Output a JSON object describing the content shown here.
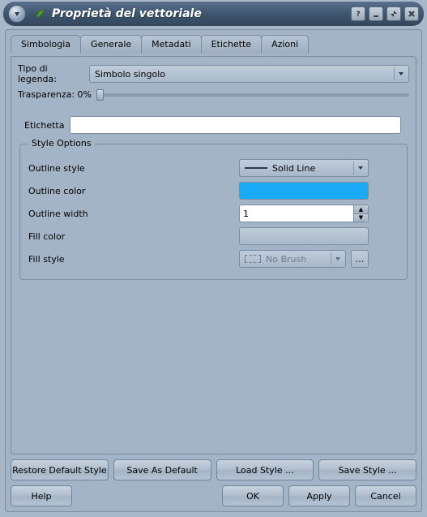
{
  "window": {
    "title": "Proprietà del vettoriale"
  },
  "tabs": {
    "simbologia": "Simbologia",
    "generale": "Generale",
    "metadati": "Metadati",
    "etichette": "Etichette",
    "azioni": "Azioni"
  },
  "legend": {
    "label": "Tipo di legenda:",
    "value": "Simbolo singolo"
  },
  "transparency": {
    "label": "Trasparenza: 0%"
  },
  "etichetta": {
    "label": "Etichetta",
    "value": ""
  },
  "style_options": {
    "title": "Style Options",
    "outline_style": {
      "label": "Outline style",
      "value": "Solid Line"
    },
    "outline_color": {
      "label": "Outline color",
      "value": "#1aa9f4"
    },
    "outline_width": {
      "label": "Outline width",
      "value": "1"
    },
    "fill_color": {
      "label": "Fill color"
    },
    "fill_style": {
      "label": "Fill style",
      "value": "No Brush"
    },
    "dots": "..."
  },
  "buttons": {
    "restore": "Restore Default Style",
    "save_default": "Save As Default",
    "load_style": "Load Style ...",
    "save_style": "Save Style ...",
    "help": "Help",
    "ok": "OK",
    "apply": "Apply",
    "cancel": "Cancel"
  }
}
